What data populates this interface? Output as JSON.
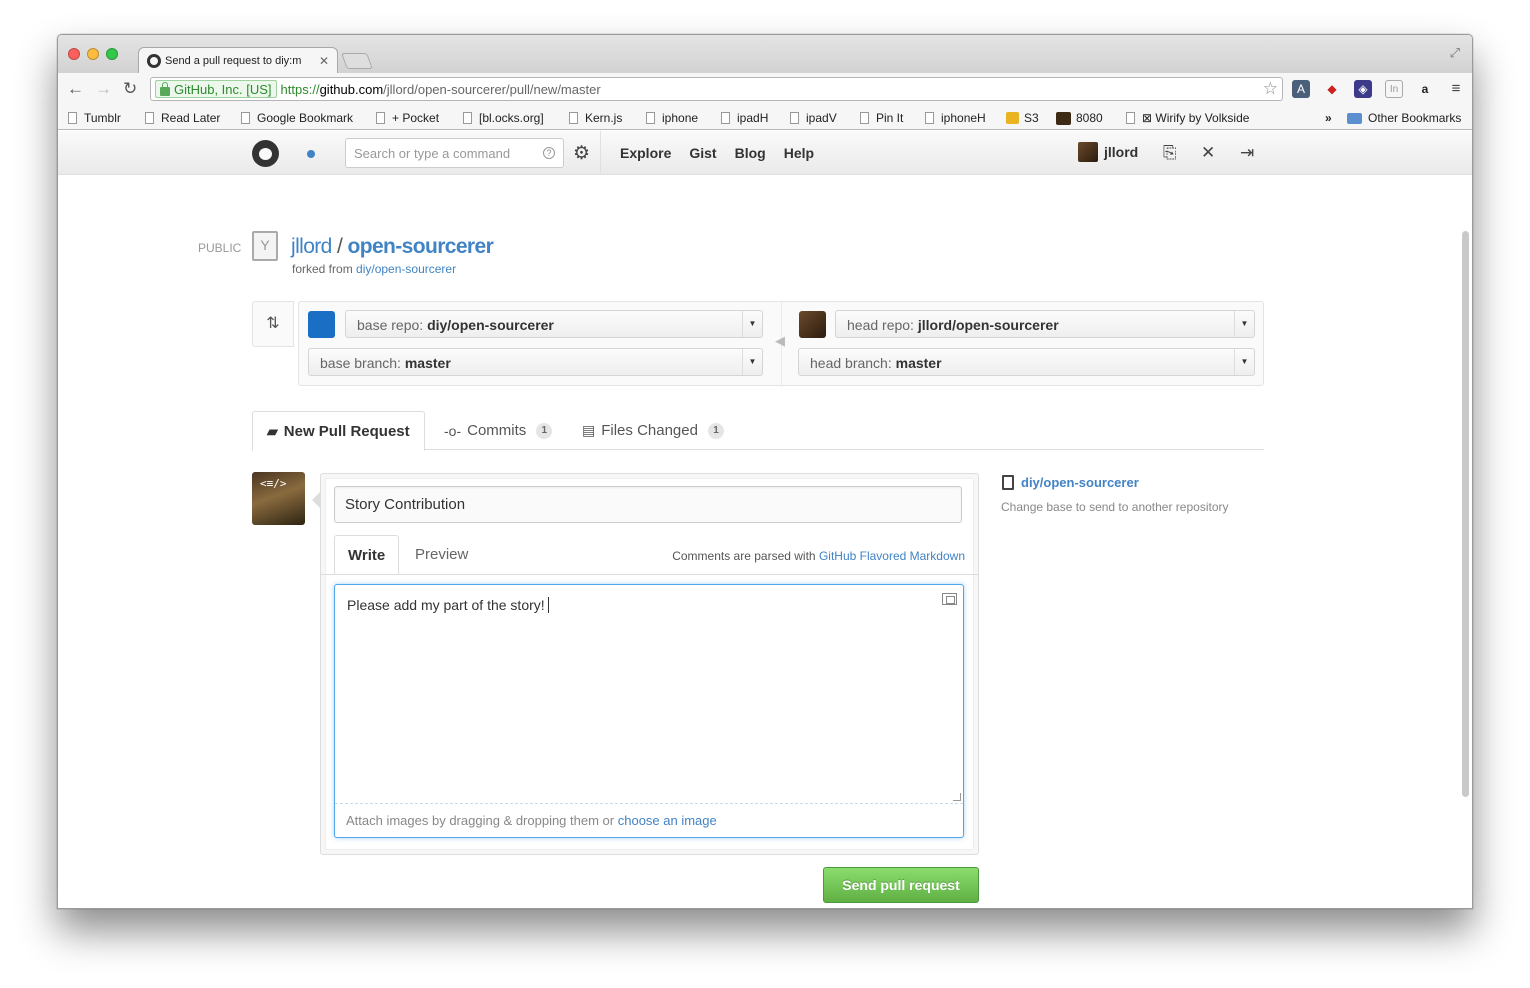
{
  "browser": {
    "tab_title": "Send a pull request to diy:m",
    "ev_label": "GitHub, Inc. [US]",
    "url_scheme": "https://",
    "url_host": "github.com",
    "url_path": "/jllord/open-sourcerer/pull/new/master",
    "bookmarks": [
      "Tumblr",
      "Read Later",
      "Google Bookmark",
      "+ Pocket",
      "[bl.ocks.org]",
      "Kern.js",
      "iphone",
      "ipadH",
      "ipadV",
      "Pin It",
      "iphoneH",
      "S3",
      "8080",
      "⊠ Wirify by Volkside"
    ],
    "overflow": "»",
    "other_bookmarks": "Other Bookmarks"
  },
  "github": {
    "search_placeholder": "Search or type a command",
    "nav": [
      "Explore",
      "Gist",
      "Blog",
      "Help"
    ],
    "username": "jllord"
  },
  "repo": {
    "visibility": "PUBLIC",
    "owner": "jllord",
    "separator": "/",
    "name": "open-sourcerer",
    "forked_prefix": "forked from",
    "forked_link": "diy/open-sourcerer"
  },
  "compare": {
    "base_repo_label": "base repo:",
    "base_repo_value": "diy/open-sourcerer",
    "base_branch_label": "base branch:",
    "base_branch_value": "master",
    "head_repo_label": "head repo:",
    "head_repo_value": "jllord/open-sourcerer",
    "head_branch_label": "head branch:",
    "head_branch_value": "master"
  },
  "tabs": {
    "new_pr": "New Pull Request",
    "commits": "Commits",
    "commits_count": "1",
    "files": "Files Changed",
    "files_count": "1"
  },
  "form": {
    "title_value": "Story Contribution",
    "write_tab": "Write",
    "preview_tab": "Preview",
    "md_prefix": "Comments are parsed with",
    "md_link": "GitHub Flavored Markdown",
    "body_value": "Please add my part of the story!",
    "attach_prefix": "Attach images by dragging & dropping them or",
    "attach_link": "choose an image",
    "submit": "Send pull request"
  },
  "sidebar": {
    "repo": "diy/open-sourcerer",
    "note": "Change base to send to another repository"
  },
  "colors": {
    "link": "#4183c4",
    "submit_green": "#60b044",
    "focus_blue": "#51a7e8"
  }
}
